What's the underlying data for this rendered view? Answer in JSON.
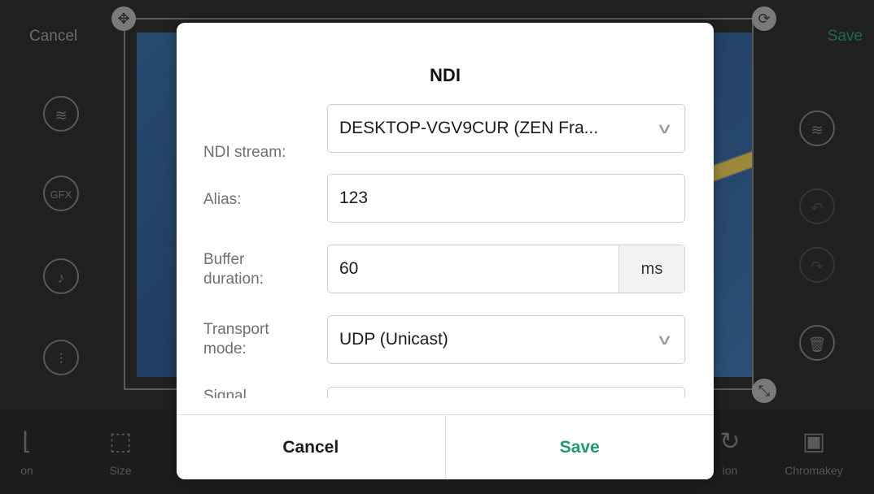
{
  "background": {
    "top_cancel": "Cancel",
    "top_save": "Save",
    "bottom_tools": [
      {
        "label": "on",
        "icon": "position-icon"
      },
      {
        "label": "Size",
        "icon": "size-icon"
      },
      {
        "label": "ion",
        "icon": "rotation-icon"
      },
      {
        "label": "Chromakey",
        "icon": "chromakey-icon"
      }
    ]
  },
  "dialog": {
    "title": "NDI",
    "fields": {
      "ndi_stream": {
        "label": "NDI stream:",
        "value": "DESKTOP-VGV9CUR (ZEN Fra..."
      },
      "alias": {
        "label": "Alias:",
        "value": "123"
      },
      "buffer_duration": {
        "label": "Buffer duration:",
        "value": "60",
        "unit": "ms"
      },
      "transport_mode": {
        "label": "Transport mode:",
        "value": "UDP (Unicast)"
      },
      "signal": {
        "label": "Signal",
        "value": ""
      }
    },
    "cancel_label": "Cancel",
    "save_label": "Save"
  },
  "colors": {
    "accent": "#1e9a6d",
    "dialog_bg": "#ffffff",
    "overlay_bg": "#1b1b1b"
  }
}
